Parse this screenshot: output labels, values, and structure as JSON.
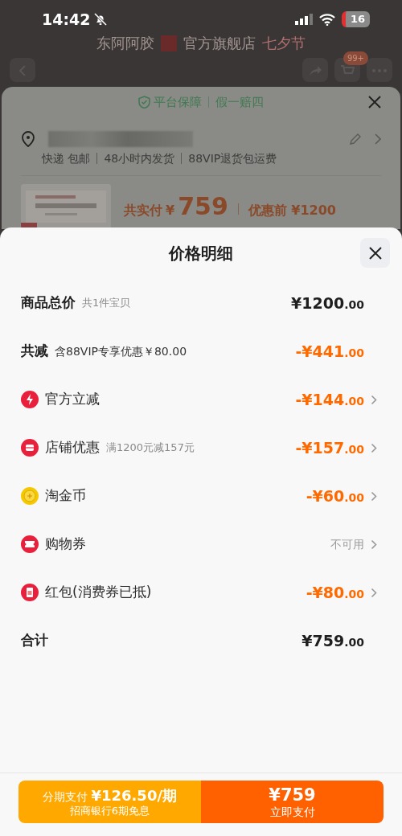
{
  "status_bar": {
    "time": "14:42",
    "battery": "16"
  },
  "store_header": {
    "brand": "东阿阿胶",
    "store": "官方旗舰店",
    "festival": "七夕节"
  },
  "nav": {
    "badge": "99+"
  },
  "back_sheet": {
    "guarantee": "平台保障",
    "guarantee_note": "假一赔四",
    "shipping": [
      "快递 包邮",
      "48小时内发货",
      "88VIP退货包运费"
    ],
    "paid_label": "共实付",
    "paid_currency": "¥",
    "paid_amount": "759",
    "before_label": "优惠前 ¥1200"
  },
  "sheet": {
    "title": "价格明细",
    "rows": [
      {
        "kind": "summary",
        "label": "商品总价",
        "note": "共1件宝贝",
        "amount": "¥1200.00",
        "color": "#1f1f1f",
        "expandable": false
      },
      {
        "kind": "summary",
        "label": "共减",
        "note": "含88VIP专享优惠￥80.00",
        "amount": "-¥441.00",
        "color": "#ff6a00",
        "expandable": false
      },
      {
        "kind": "bolt",
        "label": "官方立减",
        "amount": "-¥144.00",
        "color": "#ff6a00",
        "expandable": true
      },
      {
        "kind": "shop",
        "label": "店铺优惠",
        "note": "满1200元减157元",
        "amount": "-¥157.00",
        "color": "#ff6a00",
        "expandable": true
      },
      {
        "kind": "coin",
        "label": "淘金币",
        "amount": "-¥60.00",
        "color": "#ff6a00",
        "expandable": true
      },
      {
        "kind": "ticket",
        "label": "购物券",
        "status": "不可用",
        "expandable": true
      },
      {
        "kind": "envelope",
        "label": "红包(消费券已抵)",
        "amount": "-¥80.00",
        "color": "#ff6a00",
        "expandable": true
      },
      {
        "kind": "total",
        "label": "合计",
        "amount": "¥759.00",
        "color": "#1f1f1f",
        "expandable": false
      }
    ]
  },
  "footer": {
    "installment": {
      "label": "分期支付",
      "amount": "¥126.50/期",
      "note": "招商银行6期免息"
    },
    "pay": {
      "amount": "¥759",
      "label": "立即支付"
    }
  }
}
